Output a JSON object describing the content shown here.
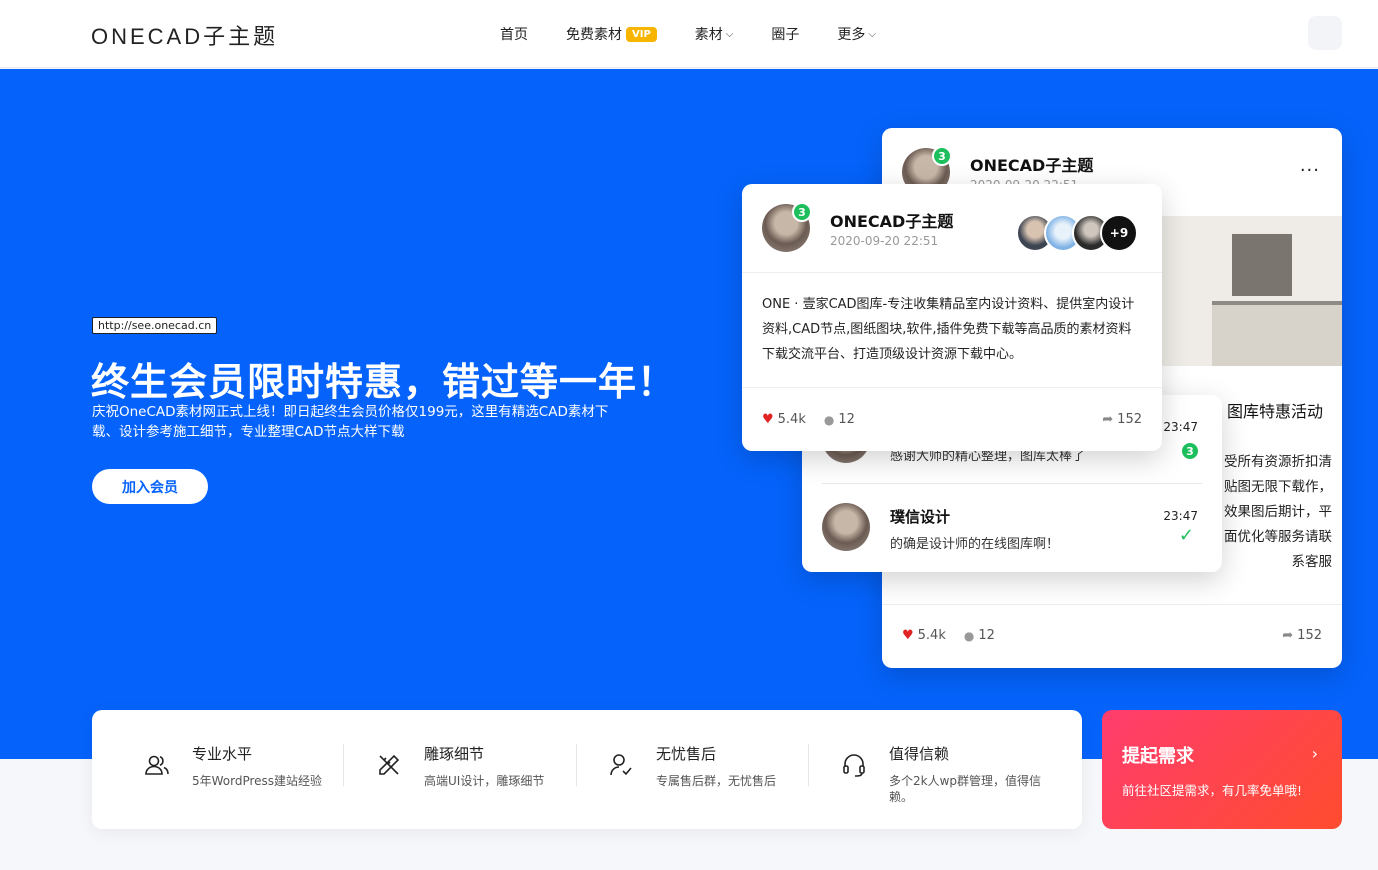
{
  "brand": {
    "logo": "ONECAD子主题"
  },
  "nav": {
    "items": [
      {
        "label": "首页"
      },
      {
        "label": "免费素材",
        "badge": "VIP"
      },
      {
        "label": "素材",
        "dropdown": true
      },
      {
        "label": "圈子"
      },
      {
        "label": "更多",
        "dropdown": true
      }
    ]
  },
  "hero": {
    "url": "http://see.onecad.cn",
    "title": "终生会员限时特惠，错过等一年！",
    "description": "庆祝OneCAD素材网正式上线！即日起终生会员价格仅199元，这里有精选CAD素材下载、设计参考施工细节，专业整理CAD节点大样下载",
    "button": "加入会员"
  },
  "back_card": {
    "name": "ONECAD子主题",
    "time": "2020-09-20 22:51",
    "badge": "3",
    "more": "···",
    "title": "图库特惠活动",
    "text": "受所有资源折扣清贴图无限下载作，效果图后期计，平面优化等服务请联系客服",
    "likes": "5.4k",
    "comments": "12",
    "shares": "152"
  },
  "chat_card": {
    "row1": {
      "time": "23:47",
      "msg": "感谢大师的精心整理，图库太棒了",
      "badge": "3"
    },
    "row2": {
      "name": "璞信设计",
      "time": "23:47",
      "msg": "的确是设计师的在线图库啊！"
    }
  },
  "front_card": {
    "name": "ONECAD子主题",
    "time": "2020-09-20 22:51",
    "badge": "3",
    "more_count": "+9",
    "text": "ONE · 壹家CAD图库-专注收集精品室内设计资料、提供室内设计资料,CAD节点,图纸图块,软件,插件免费下载等高品质的素材资料下载交流平台、打造顶级设计资源下载中心。",
    "likes": "5.4k",
    "comments": "12",
    "shares": "152"
  },
  "features": [
    {
      "title": "专业水平",
      "desc": "5年WordPress建站经验",
      "icon": "users-icon"
    },
    {
      "title": "雕琢细节",
      "desc": "高端UI设计，雕琢细节",
      "icon": "pen-ruler-icon"
    },
    {
      "title": "无忧售后",
      "desc": "专属售后群，无忧售后",
      "icon": "user-check-icon"
    },
    {
      "title": "值得信赖",
      "desc": "多个2k人wp群管理，值得信赖。",
      "icon": "headset-icon"
    }
  ],
  "cta": {
    "title": "提起需求",
    "desc": "前往社区提需求，有几率免单哦!",
    "arrow": "›"
  },
  "colors": {
    "hero_bg": "#0563fb",
    "cta_start": "#ff3d6e",
    "cta_end": "#ff4c2e",
    "vip": "#f7b500",
    "badge_green": "#1dbf5c"
  }
}
